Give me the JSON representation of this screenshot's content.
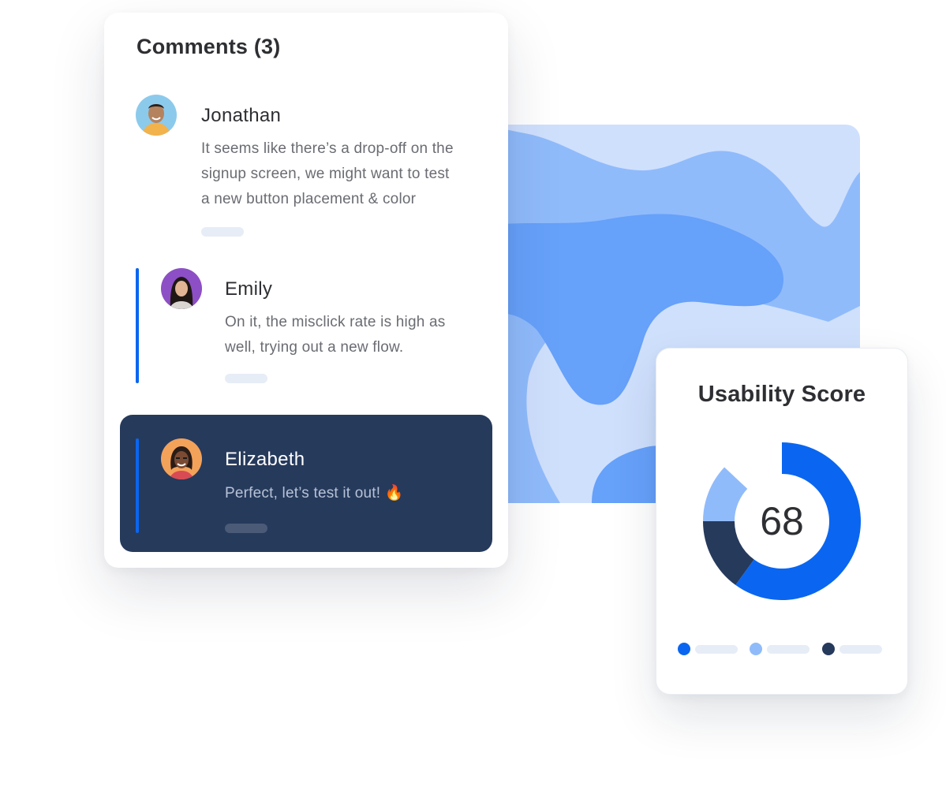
{
  "comments": {
    "title": "Comments (3)",
    "items": [
      {
        "name": "Jonathan",
        "text_lines": [
          "It seems like there’s a drop-off on the",
          "signup screen, we might want to test",
          "a new button placement & color"
        ]
      },
      {
        "name": "Emily",
        "text_lines": [
          "On it, the misclick rate is high as",
          "well, trying out a new flow."
        ]
      },
      {
        "name": "Elizabeth",
        "text_lines": [
          "Perfect, let’s test it out! 🔥"
        ]
      }
    ]
  },
  "usability": {
    "title": "Usability Score",
    "score": "68"
  },
  "colors": {
    "accent": "#0a66f0",
    "light_blue": "#90bbfb",
    "navy": "#263a5c",
    "text_dark": "#2e2f33",
    "text_muted": "#6a6c72"
  },
  "chart_data": {
    "type": "pie",
    "segments": [
      {
        "value": 60,
        "color": "#0a66f0"
      },
      {
        "value": 15,
        "color": "#263a5c"
      },
      {
        "value": 12,
        "color": "#90bbfb"
      },
      {
        "value": 13,
        "color": "none"
      }
    ],
    "center_value": 68
  }
}
